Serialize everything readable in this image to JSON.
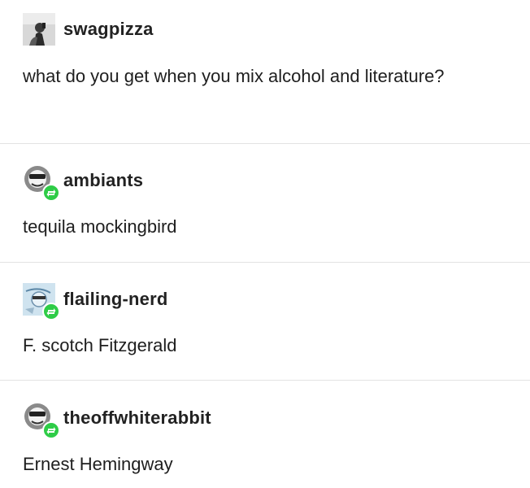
{
  "posts": [
    {
      "username": "swagpizza",
      "avatar_icon": "person-photo-icon",
      "text": "what do you get when you mix alcohol and literature?",
      "reblog": false
    },
    {
      "username": "ambiants",
      "avatar_icon": "sunglasses-face-icon",
      "text": "tequila mockingbird",
      "reblog": true
    },
    {
      "username": "flailing-nerd",
      "avatar_icon": "blue-sketch-icon",
      "text": "F. scotch Fitzgerald",
      "reblog": true
    },
    {
      "username": "theoffwhiterabbit",
      "avatar_icon": "sunglasses-face-icon",
      "text": "Ernest Hemingway",
      "reblog": true
    }
  ],
  "colors": {
    "reblog_badge": "#2ecc47",
    "divider": "#e3e3e3",
    "text": "#1e1e1e"
  }
}
